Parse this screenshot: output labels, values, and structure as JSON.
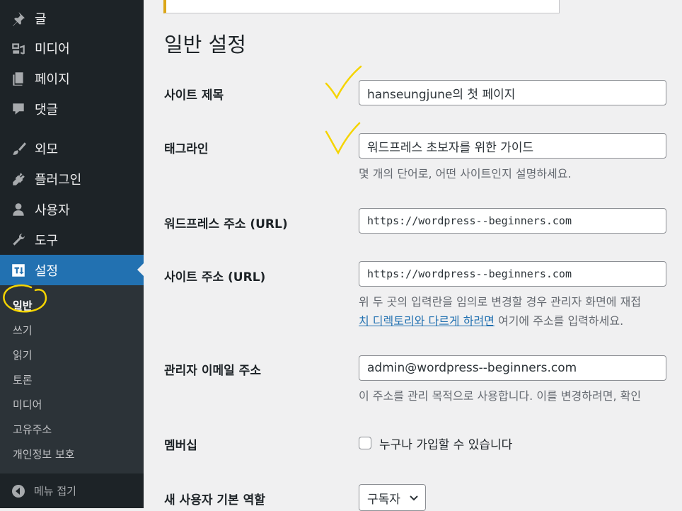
{
  "sidebar": {
    "menu": [
      {
        "label": "글",
        "icon": "pin-icon"
      },
      {
        "label": "미디어",
        "icon": "media-icon"
      },
      {
        "label": "페이지",
        "icon": "page-icon"
      },
      {
        "label": "댓글",
        "icon": "comment-icon"
      },
      {
        "label": "외모",
        "icon": "paintbrush-icon"
      },
      {
        "label": "플러그인",
        "icon": "plugin-icon"
      },
      {
        "label": "사용자",
        "icon": "user-icon"
      },
      {
        "label": "도구",
        "icon": "wrench-icon"
      },
      {
        "label": "설정",
        "icon": "settings-icon",
        "active": true
      }
    ],
    "submenu": [
      "일반",
      "쓰기",
      "읽기",
      "토론",
      "미디어",
      "고유주소",
      "개인정보 보호"
    ],
    "collapse_label": "메뉴 접기"
  },
  "page": {
    "title": "일반 설정",
    "fields": {
      "site_title": {
        "label": "사이트 제목",
        "value": "hanseungjune의 첫 페이지"
      },
      "tagline": {
        "label": "태그라인",
        "value": "워드프레스 초보자를 위한 가이드",
        "description": "몇 개의 단어로, 어떤 사이트인지 설명하세요."
      },
      "wp_address": {
        "label": "워드프레스 주소 (URL)",
        "value": "https://wordpress--beginners.com"
      },
      "site_address": {
        "label": "사이트 주소 (URL)",
        "value": "https://wordpress--beginners.com",
        "description_line1": "위 두 곳의 입력란을 임의로 변경할 경우 관리자 화면에 재접",
        "description_link": "치 디렉토리와 다르게 하려면",
        "description_line2_rest": " 여기에 주소를 입력하세요."
      },
      "admin_email": {
        "label": "관리자 이메일 주소",
        "value": "admin@wordpress--beginners.com",
        "description": "이 주소를 관리 목적으로 사용합니다. 이를 변경하려면, 확인"
      },
      "membership": {
        "label": "멤버십",
        "checkbox_label": "누구나 가입할 수 있습니다",
        "checked": false
      },
      "default_role": {
        "label": "새 사용자 기본 역할",
        "selected": "구독자"
      }
    }
  },
  "colors": {
    "sidebar_bg": "#1d2327",
    "submenu_bg": "#2c3338",
    "accent": "#2271b1",
    "annotation": "#f5d400",
    "notice_border": "#dba617"
  }
}
